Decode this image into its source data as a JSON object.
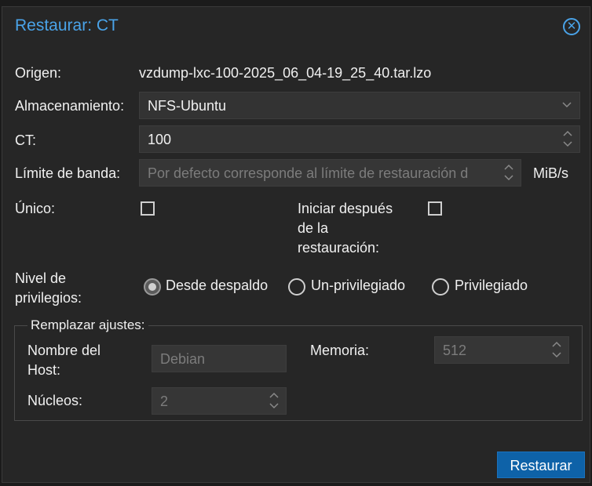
{
  "dialog": {
    "title": "Restaurar: CT",
    "close_icon": "close-circle-icon"
  },
  "form": {
    "origen_label": "Origen:",
    "origen_value": "vzdump-lxc-100-2025_06_04-19_25_40.tar.lzo",
    "storage_label": "Almacenamiento:",
    "storage_value": "NFS-Ubuntu",
    "ct_label": "CT:",
    "ct_value": "100",
    "bw_label": "Límite de banda:",
    "bw_placeholder": "Por defecto corresponde al límite de restauración d",
    "bw_unit": "MiB/s",
    "unique_label": "Único:",
    "start_after_label_1": "Iniciar después",
    "start_after_label_2": "de la",
    "start_after_label_3": "restauración:",
    "priv_label_1": "Nivel de",
    "priv_label_2": "privilegios:",
    "priv_options": [
      "Desde despaldo",
      "Un-privilegiado",
      "Privilegiado"
    ],
    "priv_selected": "Desde despaldo"
  },
  "override": {
    "legend": "Remplazar ajustes:",
    "hostname_label_1": "Nombre del",
    "hostname_label_2": "Host:",
    "hostname_placeholder": "Debian",
    "memory_label": "Memoria:",
    "memory_placeholder": "512",
    "cores_label": "Núcleos:",
    "cores_placeholder": "2"
  },
  "footer": {
    "restore_label": "Restaurar"
  }
}
